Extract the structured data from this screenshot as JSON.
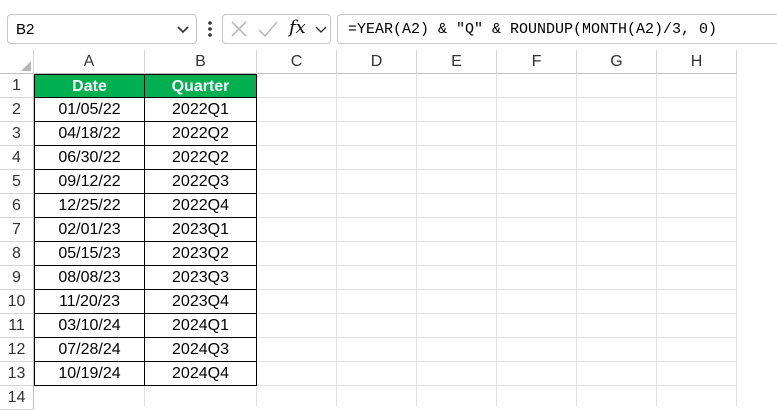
{
  "formula_bar": {
    "name_box": "B2",
    "fx": "fx",
    "formula": "=YEAR(A2) & \"Q\" & ROUNDUP(MONTH(A2)/3, 0)"
  },
  "columns": [
    "A",
    "B",
    "C",
    "D",
    "E",
    "F",
    "G",
    "H"
  ],
  "rows": [
    "1",
    "2",
    "3",
    "4",
    "5",
    "6",
    "7",
    "8",
    "9",
    "10",
    "11",
    "12",
    "13",
    "14"
  ],
  "table": {
    "headers": [
      "Date",
      "Quarter"
    ],
    "rows": [
      [
        "01/05/22",
        "2022Q1"
      ],
      [
        "04/18/22",
        "2022Q2"
      ],
      [
        "06/30/22",
        "2022Q2"
      ],
      [
        "09/12/22",
        "2022Q3"
      ],
      [
        "12/25/22",
        "2022Q4"
      ],
      [
        "02/01/23",
        "2023Q1"
      ],
      [
        "05/15/23",
        "2023Q2"
      ],
      [
        "08/08/23",
        "2023Q3"
      ],
      [
        "11/20/23",
        "2023Q4"
      ],
      [
        "03/10/24",
        "2024Q1"
      ],
      [
        "07/28/24",
        "2024Q3"
      ],
      [
        "10/19/24",
        "2024Q4"
      ]
    ]
  },
  "colors": {
    "header_fill": "#00b050",
    "header_text": "#ffffff"
  }
}
